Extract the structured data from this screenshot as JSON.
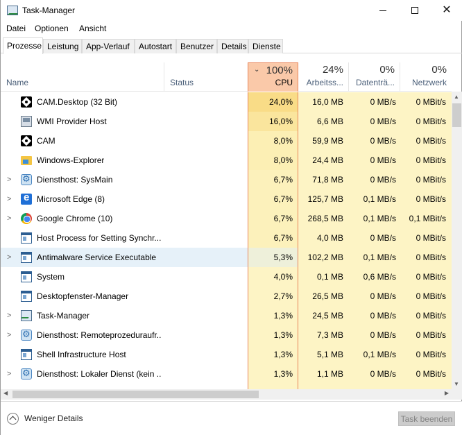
{
  "window": {
    "title": "Task-Manager"
  },
  "menu": [
    "Datei",
    "Optionen",
    "Ansicht"
  ],
  "tabs": [
    {
      "label": "Prozesse",
      "active": true
    },
    {
      "label": "Leistung"
    },
    {
      "label": "App-Verlauf"
    },
    {
      "label": "Autostart"
    },
    {
      "label": "Benutzer"
    },
    {
      "label": "Details"
    },
    {
      "label": "Dienste"
    }
  ],
  "columns": {
    "name": {
      "label": "Name"
    },
    "status": {
      "label": "Status"
    },
    "cpu": {
      "pct": "100%",
      "label": "CPU",
      "sorted": true
    },
    "memory": {
      "pct": "24%",
      "label": "Arbeitss..."
    },
    "disk": {
      "pct": "0%",
      "label": "Datenträ..."
    },
    "network": {
      "pct": "0%",
      "label": "Netzwerk"
    }
  },
  "processes": [
    {
      "name": "CAM.Desktop (32 Bit)",
      "icon": "cam-icon",
      "expandable": false,
      "status": "",
      "cpu": "24,0%",
      "memory": "16,0 MB",
      "disk": "0 MB/s",
      "network": "0 MBit/s",
      "cpu_heat": "#f9dc87"
    },
    {
      "name": "WMI Provider Host",
      "icon": "wmi-icon",
      "expandable": false,
      "status": "",
      "cpu": "16,0%",
      "memory": "6,6 MB",
      "disk": "0 MB/s",
      "network": "0 MBit/s",
      "cpu_heat": "#fae59d"
    },
    {
      "name": "CAM",
      "icon": "cam-icon",
      "expandable": false,
      "status": "",
      "cpu": "8,0%",
      "memory": "59,9 MB",
      "disk": "0 MB/s",
      "network": "0 MBit/s",
      "cpu_heat": "#fcefb4"
    },
    {
      "name": "Windows-Explorer",
      "icon": "folder-icon",
      "expandable": false,
      "status": "",
      "cpu": "8,0%",
      "memory": "24,4 MB",
      "disk": "0 MB/s",
      "network": "0 MBit/s",
      "cpu_heat": "#fcefb4"
    },
    {
      "name": "Diensthost: SysMain",
      "icon": "gear-icon",
      "expandable": true,
      "status": "",
      "cpu": "6,7%",
      "memory": "71,8 MB",
      "disk": "0 MB/s",
      "network": "0 MBit/s",
      "cpu_heat": "#fcf1bb"
    },
    {
      "name": "Microsoft Edge (8)",
      "icon": "edge-icon",
      "expandable": true,
      "status": "",
      "cpu": "6,7%",
      "memory": "125,7 MB",
      "disk": "0,1 MB/s",
      "network": "0 MBit/s",
      "cpu_heat": "#fcf1bb"
    },
    {
      "name": "Google Chrome (10)",
      "icon": "chrome-icon",
      "expandable": true,
      "status": "",
      "cpu": "6,7%",
      "memory": "268,5 MB",
      "disk": "0,1 MB/s",
      "network": "0,1 MBit/s",
      "cpu_heat": "#fcf1bb"
    },
    {
      "name": "Host Process for Setting Synchr...",
      "icon": "window-icon",
      "expandable": false,
      "status": "",
      "cpu": "6,7%",
      "memory": "4,0 MB",
      "disk": "0 MB/s",
      "network": "0 MBit/s",
      "cpu_heat": "#fcf1bb"
    },
    {
      "name": "Antimalware Service Executable",
      "icon": "window-icon",
      "expandable": true,
      "selected": true,
      "status": "",
      "cpu": "5,3%",
      "memory": "102,2 MB",
      "disk": "0,1 MB/s",
      "network": "0 MBit/s",
      "cpu_heat": "#eef0da"
    },
    {
      "name": "System",
      "icon": "window-icon",
      "expandable": false,
      "status": "",
      "cpu": "4,0%",
      "memory": "0,1 MB",
      "disk": "0,6 MB/s",
      "network": "0 MBit/s",
      "cpu_heat": "#fdf4c5"
    },
    {
      "name": "Desktopfenster-Manager",
      "icon": "window-icon",
      "expandable": false,
      "status": "",
      "cpu": "2,7%",
      "memory": "26,5 MB",
      "disk": "0 MB/s",
      "network": "0 MBit/s",
      "cpu_heat": "#fdf4c5"
    },
    {
      "name": "Task-Manager",
      "icon": "task-manager-icon",
      "expandable": true,
      "status": "",
      "cpu": "1,3%",
      "memory": "24,5 MB",
      "disk": "0 MB/s",
      "network": "0 MBit/s",
      "cpu_heat": "#fdf4c5"
    },
    {
      "name": "Diensthost: Remoteprozeduraufr...",
      "icon": "gear-icon",
      "expandable": true,
      "status": "",
      "cpu": "1,3%",
      "memory": "7,3 MB",
      "disk": "0 MB/s",
      "network": "0 MBit/s",
      "cpu_heat": "#fdf4c5"
    },
    {
      "name": "Shell Infrastructure Host",
      "icon": "window-icon",
      "expandable": false,
      "status": "",
      "cpu": "1,3%",
      "memory": "5,1 MB",
      "disk": "0,1 MB/s",
      "network": "0 MBit/s",
      "cpu_heat": "#fdf4c5"
    },
    {
      "name": "Diensthost: Lokaler Dienst (kein ...",
      "icon": "gear-icon",
      "expandable": true,
      "status": "",
      "cpu": "1,3%",
      "memory": "1,1 MB",
      "disk": "0 MB/s",
      "network": "0 MBit/s",
      "cpu_heat": "#fdf4c5"
    }
  ],
  "colors": {
    "cpu_header": "#fac9a9",
    "cpu_border": "#e8845a",
    "metric_cell": "#fdf4c5",
    "selection": "#e6f1f9"
  },
  "footer": {
    "fewer_details": "Weniger Details",
    "end_task": "Task beenden"
  }
}
